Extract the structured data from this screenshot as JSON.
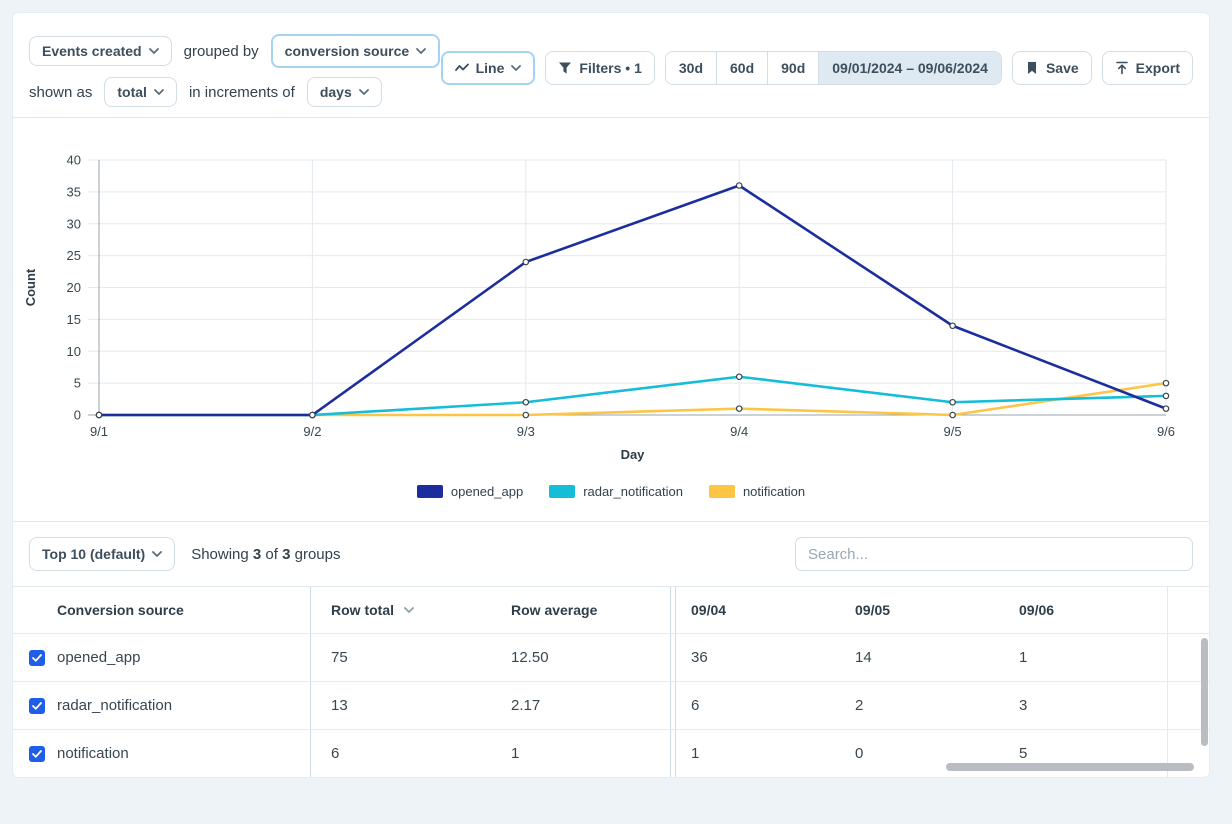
{
  "toolbar": {
    "metric_label": "Events created",
    "grouped_by_label": "grouped by",
    "group_value": "conversion source",
    "shown_as_label": "shown as",
    "shown_as_value": "total",
    "increments_label": "in increments of",
    "increments_value": "days",
    "chart_type_label": "Line",
    "filters_label": "Filters • 1",
    "range_30": "30d",
    "range_60": "60d",
    "range_90": "90d",
    "date_range": "09/01/2024 – 09/06/2024",
    "save_label": "Save",
    "export_label": "Export",
    "icons": {
      "chart_type": "line-chart-icon",
      "filters": "funnel-icon",
      "save": "bookmark-icon",
      "export": "export-up-arrow-icon",
      "dropdowns": "chevron-down-icon"
    }
  },
  "colors": {
    "accent_focus_ring": "#a6d3f4",
    "selected_segment_bg": "#dfe9f1",
    "checkbox_blue": "#1e5ee8",
    "grid_line": "#e3e9ee",
    "axis_line": "#97a3ab"
  },
  "chart_data": {
    "type": "line",
    "title": "",
    "xlabel": "Day",
    "ylabel": "Count",
    "x": [
      "9/1",
      "9/2",
      "9/3",
      "9/4",
      "9/5",
      "9/6"
    ],
    "ylim": [
      0,
      40
    ],
    "ytick_step": 5,
    "grid": true,
    "legend_position": "bottom",
    "series": [
      {
        "name": "opened_app",
        "color": "#1c2e9e",
        "values": [
          0,
          0,
          24,
          36,
          14,
          1
        ]
      },
      {
        "name": "radar_notification",
        "color": "#15bdd6",
        "values": [
          0,
          0,
          2,
          6,
          2,
          3
        ]
      },
      {
        "name": "notification",
        "color": "#fcc545",
        "values": [
          0,
          0,
          0,
          1,
          0,
          5
        ]
      }
    ]
  },
  "table_controls": {
    "top_filter_label": "Top 10 (default)",
    "summary": {
      "showing": "Showing",
      "count": "3",
      "of": "of",
      "total": "3",
      "groups": "groups"
    },
    "search_placeholder": "Search..."
  },
  "table": {
    "columns": [
      "Conversion source",
      "Row total",
      "Row average",
      "09/04",
      "09/05",
      "09/06"
    ],
    "rows": [
      {
        "checked": true,
        "label": "opened_app",
        "row_total": "75",
        "row_average": "12.50",
        "d0904": "36",
        "d0905": "14",
        "d0906": "1"
      },
      {
        "checked": true,
        "label": "radar_notification",
        "row_total": "13",
        "row_average": "2.17",
        "d0904": "6",
        "d0905": "2",
        "d0906": "3"
      },
      {
        "checked": true,
        "label": "notification",
        "row_total": "6",
        "row_average": "1",
        "d0904": "1",
        "d0905": "0",
        "d0906": "5"
      }
    ]
  }
}
